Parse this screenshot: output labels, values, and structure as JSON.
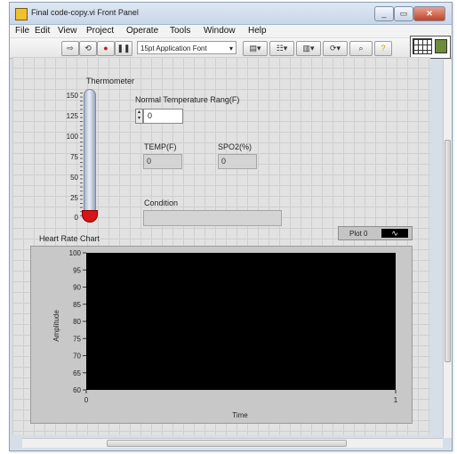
{
  "window": {
    "title": "Final code-copy.vi Front Panel",
    "buttons": {
      "minimize": "_",
      "maximize": "▭",
      "close": "✕"
    }
  },
  "menu": [
    "File",
    "Edit",
    "View",
    "Project",
    "Operate",
    "Tools",
    "Window",
    "Help"
  ],
  "toolbar": {
    "font": "15pt Application Font"
  },
  "thermometer": {
    "label": "Thermometer",
    "ticks": [
      "150",
      "125",
      "100",
      "75",
      "50",
      "25",
      "0"
    ],
    "value": 0
  },
  "normal_temp": {
    "label": "Normal Temperature Rang(F)",
    "value": "0"
  },
  "temp": {
    "label": "TEMP(F)",
    "value": "0"
  },
  "spo2": {
    "label": "SPO2(%)",
    "value": "0"
  },
  "condition": {
    "label": "Condition",
    "value": ""
  },
  "chart": {
    "title": "Heart Rate Chart",
    "legend": "Plot 0",
    "ylabel": "Amplitude",
    "xlabel": "Time",
    "y_ticks": [
      "100",
      "95",
      "90",
      "85",
      "80",
      "75",
      "70",
      "65",
      "60"
    ],
    "x_ticks": [
      "0",
      "1"
    ]
  },
  "chart_data": {
    "type": "line",
    "series": [],
    "ylim": [
      60,
      100
    ],
    "xlim": [
      0,
      1
    ],
    "xlabel": "Time",
    "ylabel": "Amplitude",
    "grid": false
  },
  "colors": {
    "plot_bg": "#000000",
    "bulb": "#d51616",
    "panel": "#e2e2e2"
  }
}
